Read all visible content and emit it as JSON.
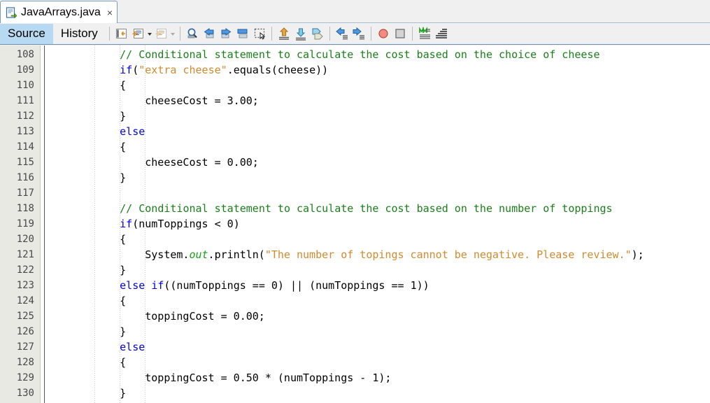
{
  "window": {
    "title": "JavaArrays.java"
  },
  "tab": {
    "label": "JavaArrays.java",
    "close": "×",
    "icon": "java-file-icon"
  },
  "viewtabs": [
    {
      "label": "Source",
      "active": true
    },
    {
      "label": "History",
      "active": false
    }
  ],
  "toolbar": {
    "buttons": [
      {
        "name": "last-edit-icon",
        "glyph": "last-edit"
      },
      {
        "name": "toggle-bookmark-icon",
        "glyph": "bookmark"
      },
      {
        "name": "bookmark-dropdown-arrow-icon",
        "glyph": "arrow"
      },
      {
        "name": "previous-bookmark-icon",
        "glyph": "bookmark-dim"
      },
      {
        "name": "bookmark-dropdown-arrow-2-icon",
        "glyph": "arrow-dim"
      },
      {
        "name": "find-selection-icon",
        "glyph": "magnifier"
      },
      {
        "name": "find-previous-icon",
        "glyph": "find-prev"
      },
      {
        "name": "find-next-icon",
        "glyph": "find-next"
      },
      {
        "name": "toggle-highlight-icon",
        "glyph": "highlight"
      },
      {
        "name": "toggle-rectangular-selection-icon",
        "glyph": "rect-select"
      },
      {
        "name": "previous-bookmark-nav-icon",
        "glyph": "up-tag"
      },
      {
        "name": "next-bookmark-nav-icon",
        "glyph": "down-tag"
      },
      {
        "name": "toggle-bookmark-nav-icon",
        "glyph": "side-tag"
      },
      {
        "name": "shift-line-left-icon",
        "glyph": "shift-left"
      },
      {
        "name": "shift-line-right-icon",
        "glyph": "shift-right"
      },
      {
        "name": "toggle-breakpoint-icon",
        "glyph": "red-circle"
      },
      {
        "name": "stop-icon",
        "glyph": "gray-square"
      },
      {
        "name": "inspect-members-icon",
        "glyph": "green-members"
      },
      {
        "name": "inspect-hierarchy-icon",
        "glyph": "hierarchy"
      }
    ]
  },
  "editor": {
    "first_line": 108,
    "lines": [
      {
        "n": 108,
        "indent": 8,
        "tokens": [
          {
            "t": "// Conditional statement to calculate the cost based on the choice of cheese",
            "c": "cmt"
          }
        ]
      },
      {
        "n": 109,
        "indent": 8,
        "tokens": [
          {
            "t": "if",
            "c": "kw"
          },
          {
            "t": "(",
            "c": "pln"
          },
          {
            "t": "\"extra cheese\"",
            "c": "str"
          },
          {
            "t": ".equals(cheese))",
            "c": "pln"
          }
        ]
      },
      {
        "n": 110,
        "indent": 8,
        "tokens": [
          {
            "t": "{",
            "c": "pln"
          }
        ]
      },
      {
        "n": 111,
        "indent": 12,
        "tokens": [
          {
            "t": "cheeseCost = 3.00;",
            "c": "pln"
          }
        ]
      },
      {
        "n": 112,
        "indent": 8,
        "tokens": [
          {
            "t": "}",
            "c": "pln"
          }
        ]
      },
      {
        "n": 113,
        "indent": 8,
        "tokens": [
          {
            "t": "else",
            "c": "kw"
          }
        ]
      },
      {
        "n": 114,
        "indent": 8,
        "tokens": [
          {
            "t": "{",
            "c": "pln"
          }
        ]
      },
      {
        "n": 115,
        "indent": 12,
        "tokens": [
          {
            "t": "cheeseCost = 0.00;",
            "c": "pln"
          }
        ]
      },
      {
        "n": 116,
        "indent": 8,
        "tokens": [
          {
            "t": "}",
            "c": "pln"
          }
        ]
      },
      {
        "n": 117,
        "indent": 0,
        "tokens": []
      },
      {
        "n": 118,
        "indent": 8,
        "tokens": [
          {
            "t": "// Conditional statement to calculate the cost based on the number of toppings",
            "c": "cmt"
          }
        ]
      },
      {
        "n": 119,
        "indent": 8,
        "tokens": [
          {
            "t": "if",
            "c": "kw"
          },
          {
            "t": "(numToppings < 0)",
            "c": "pln"
          }
        ]
      },
      {
        "n": 120,
        "indent": 8,
        "tokens": [
          {
            "t": "{",
            "c": "pln"
          }
        ]
      },
      {
        "n": 121,
        "indent": 12,
        "tokens": [
          {
            "t": "System.",
            "c": "pln"
          },
          {
            "t": "out",
            "c": "fld"
          },
          {
            "t": ".println(",
            "c": "pln"
          },
          {
            "t": "\"The number of topings cannot be negative. Please review.\"",
            "c": "str"
          },
          {
            "t": ");",
            "c": "pln"
          }
        ]
      },
      {
        "n": 122,
        "indent": 8,
        "tokens": [
          {
            "t": "}",
            "c": "pln"
          }
        ]
      },
      {
        "n": 123,
        "indent": 8,
        "tokens": [
          {
            "t": "else",
            "c": "kw"
          },
          {
            "t": " ",
            "c": "pln"
          },
          {
            "t": "if",
            "c": "kw"
          },
          {
            "t": "((numToppings == 0) || (numToppings == 1))",
            "c": "pln"
          }
        ]
      },
      {
        "n": 124,
        "indent": 8,
        "tokens": [
          {
            "t": "{",
            "c": "pln"
          }
        ]
      },
      {
        "n": 125,
        "indent": 12,
        "tokens": [
          {
            "t": "toppingCost = 0.00;",
            "c": "pln"
          }
        ]
      },
      {
        "n": 126,
        "indent": 8,
        "tokens": [
          {
            "t": "}",
            "c": "pln"
          }
        ]
      },
      {
        "n": 127,
        "indent": 8,
        "tokens": [
          {
            "t": "else",
            "c": "kw"
          }
        ]
      },
      {
        "n": 128,
        "indent": 8,
        "tokens": [
          {
            "t": "{",
            "c": "pln"
          }
        ]
      },
      {
        "n": 129,
        "indent": 12,
        "tokens": [
          {
            "t": "toppingCost = 0.50 * (numToppings - 1);",
            "c": "pln"
          }
        ]
      },
      {
        "n": 130,
        "indent": 8,
        "tokens": [
          {
            "t": "}",
            "c": "pln"
          }
        ]
      }
    ]
  },
  "colors": {
    "keyword": "#0000e6",
    "string": "#d18a2e",
    "comment": "#1a7f1a",
    "field": "#1aa11a",
    "gutter_bg": "#e9e9e4",
    "toolbar_bg": "#f0f0f0",
    "active_tab_bg": "#b8d9f2",
    "separator": "#6e8fae"
  }
}
